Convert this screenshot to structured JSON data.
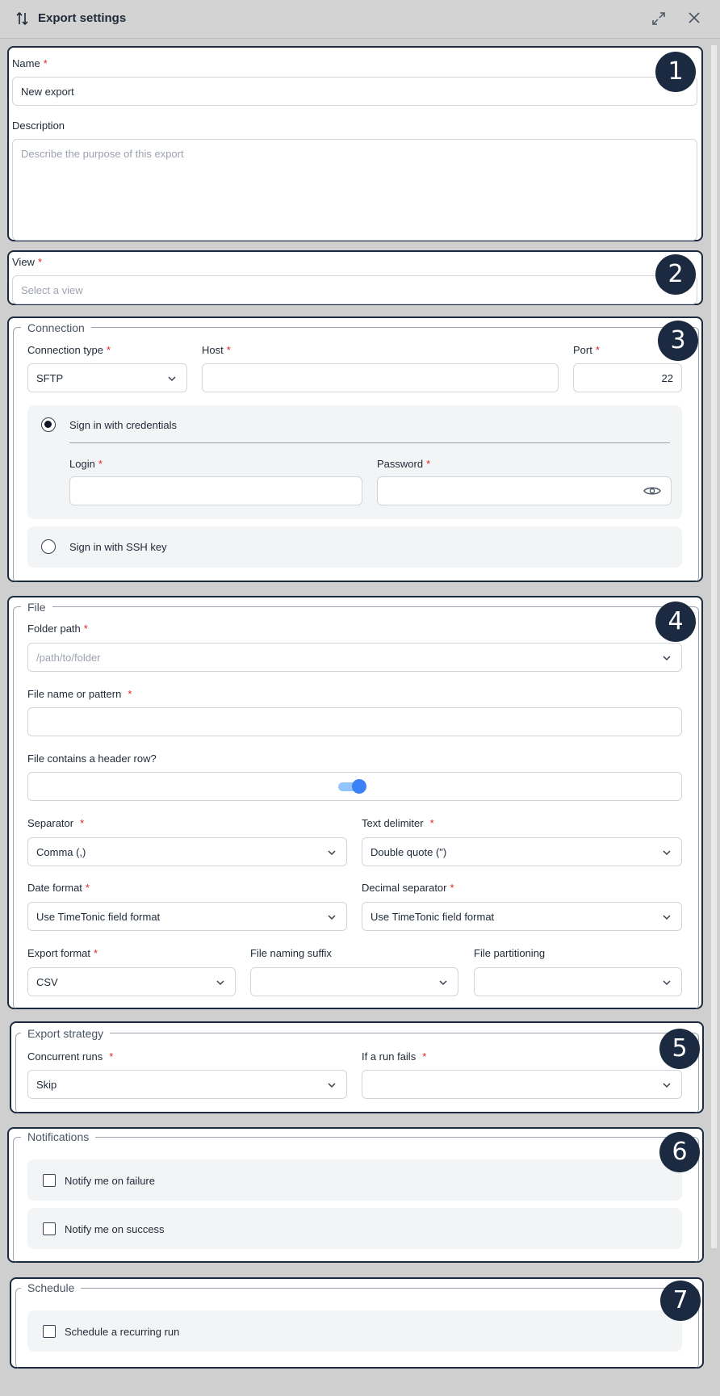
{
  "header": {
    "title": "Export settings",
    "icons": [
      "sort-arrows-icon",
      "expand-icon",
      "close-icon"
    ]
  },
  "badges": [
    "1",
    "2",
    "3",
    "4",
    "5",
    "6",
    "7"
  ],
  "general": {
    "name_label": "Name",
    "name_value": "New export",
    "description_label": "Description",
    "description_placeholder": "Describe the purpose of this export"
  },
  "view": {
    "label": "View",
    "placeholder": "Select a view"
  },
  "connection": {
    "title": "Connection",
    "type_label": "Connection type",
    "type_value": "SFTP",
    "host_label": "Host",
    "host_value": "",
    "port_label": "Port",
    "port_value": "22",
    "credentials_label": "Sign in with credentials",
    "login_label": "Login",
    "password_label": "Password",
    "ssh_label": "Sign in with SSH key"
  },
  "file": {
    "title": "File",
    "folder_label": "Folder path",
    "folder_placeholder": "/path/to/folder",
    "filename_label": "File name or pattern",
    "header_row_label": "File contains a header row?",
    "header_row_on": true,
    "separator_label": "Separator",
    "separator_value": "Comma (,)",
    "text_delim_label": "Text delimiter",
    "text_delim_value": "Double quote (\")",
    "date_format_label": "Date format",
    "date_format_value": "Use TimeTonic field format",
    "decimal_label": "Decimal separator",
    "decimal_value": "Use TimeTonic field format",
    "export_format_label": "Export format",
    "export_format_value": "CSV",
    "suffix_label": "File naming suffix",
    "partition_label": "File partitioning"
  },
  "strategy": {
    "title": "Export strategy",
    "concurrent_label": "Concurrent runs",
    "concurrent_value": "Skip",
    "fail_label": "If a run fails"
  },
  "notifications": {
    "title": "Notifications",
    "failure_label": "Notify me on failure",
    "success_label": "Notify me on success"
  },
  "schedule": {
    "title": "Schedule",
    "recurring_label": "Schedule a recurring run"
  },
  "colors": {
    "badge": "#1b2a40",
    "required": "#dc2626",
    "toggle": "#3b82f6"
  }
}
